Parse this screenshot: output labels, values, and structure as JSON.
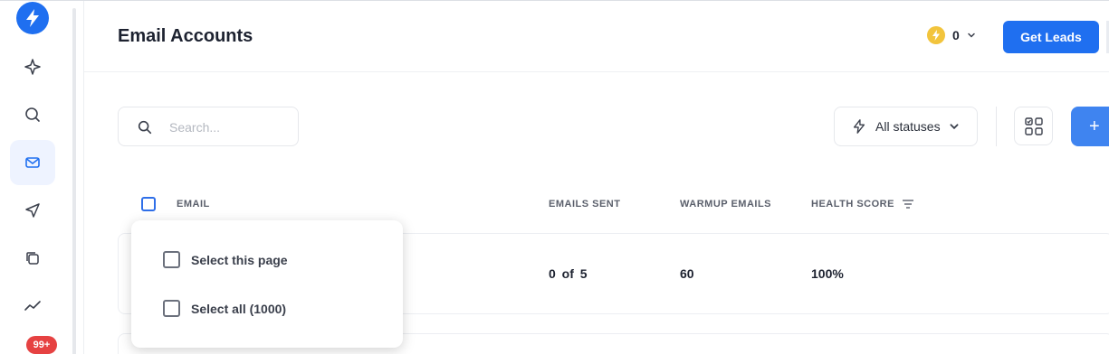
{
  "sidebar": {
    "logo": "lightning-logo",
    "items": [
      {
        "icon": "sparkle-icon"
      },
      {
        "icon": "search-icon"
      },
      {
        "icon": "mail-icon",
        "active": true
      },
      {
        "icon": "send-icon"
      },
      {
        "icon": "copy-icon"
      },
      {
        "icon": "trend-icon"
      }
    ],
    "badge": "99+"
  },
  "header": {
    "title": "Email Accounts",
    "credits": "0",
    "get_leads_label": "Get Leads"
  },
  "toolbar": {
    "search_placeholder": "Search...",
    "status_filter_label": "All statuses",
    "add_label": "+"
  },
  "table": {
    "columns": [
      "EMAIL",
      "EMAILS SENT",
      "WARMUP EMAILS",
      "HEALTH SCORE"
    ],
    "rows": [
      {
        "emails_sent": "0  of  5",
        "warmup_emails": "60",
        "health_score": "100%"
      }
    ]
  },
  "select_menu": {
    "options": [
      "Select this page",
      "Select all (1000)"
    ]
  },
  "colors": {
    "accent": "#1f6ff0",
    "badge": "#e64242",
    "coin": "#f2c43c"
  }
}
